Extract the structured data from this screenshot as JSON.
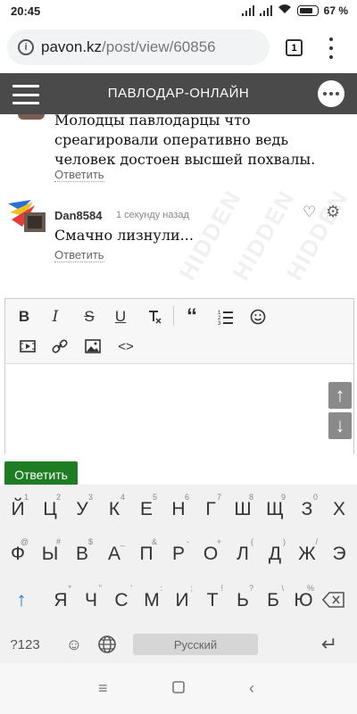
{
  "status": {
    "time": "20:45",
    "battery": "67 %"
  },
  "browser": {
    "domain": "pavon.kz",
    "path": "/post/view/60856",
    "tab_count": "1"
  },
  "site": {
    "title": "ПАВЛОДАР-ОНЛАЙН"
  },
  "comments": [
    {
      "text_line1": "Молодцы павлодарцы что",
      "text_line2": "среагировали оперативно ведь",
      "text_line3": "человек достоен высшей похвалы.",
      "reply": "Ответить"
    },
    {
      "author": "Dan8584",
      "ago": "1 секунду назад",
      "text": "Смачно лизнули...",
      "reply": "Ответить"
    }
  ],
  "watermark": "HIDDEN",
  "editor": {
    "submit_label": "Ответить"
  },
  "keyboard": {
    "row1": [
      {
        "k": "Й",
        "s": "1"
      },
      {
        "k": "Ц",
        "s": "2"
      },
      {
        "k": "У",
        "s": "3"
      },
      {
        "k": "К",
        "s": "4"
      },
      {
        "k": "Е",
        "s": "5"
      },
      {
        "k": "Н",
        "s": "6"
      },
      {
        "k": "Г",
        "s": "7"
      },
      {
        "k": "Ш",
        "s": "8"
      },
      {
        "k": "Щ",
        "s": "9"
      },
      {
        "k": "З",
        "s": "0"
      },
      {
        "k": "Х",
        "s": ""
      }
    ],
    "row2": [
      {
        "k": "Ф",
        "s": "@"
      },
      {
        "k": "Ы",
        "s": "#"
      },
      {
        "k": "В",
        "s": "$"
      },
      {
        "k": "А",
        "s": "_"
      },
      {
        "k": "П",
        "s": "&"
      },
      {
        "k": "Р",
        "s": "-"
      },
      {
        "k": "О",
        "s": "+"
      },
      {
        "k": "Л",
        "s": "("
      },
      {
        "k": "Д",
        "s": ")"
      },
      {
        "k": "Ж",
        "s": "/"
      },
      {
        "k": "Э",
        "s": ""
      }
    ],
    "row3": [
      {
        "k": "Я",
        "s": "*"
      },
      {
        "k": "Ч",
        "s": "\""
      },
      {
        "k": "С",
        "s": "'"
      },
      {
        "k": "М",
        "s": ":"
      },
      {
        "k": "И",
        "s": ";"
      },
      {
        "k": "Т",
        "s": "!"
      },
      {
        "k": "Ь",
        "s": "?"
      },
      {
        "k": "Б",
        "s": "\\"
      },
      {
        "k": "Ю",
        "s": "%"
      }
    ],
    "symbols_label": "?123",
    "space_label": "Русский"
  }
}
